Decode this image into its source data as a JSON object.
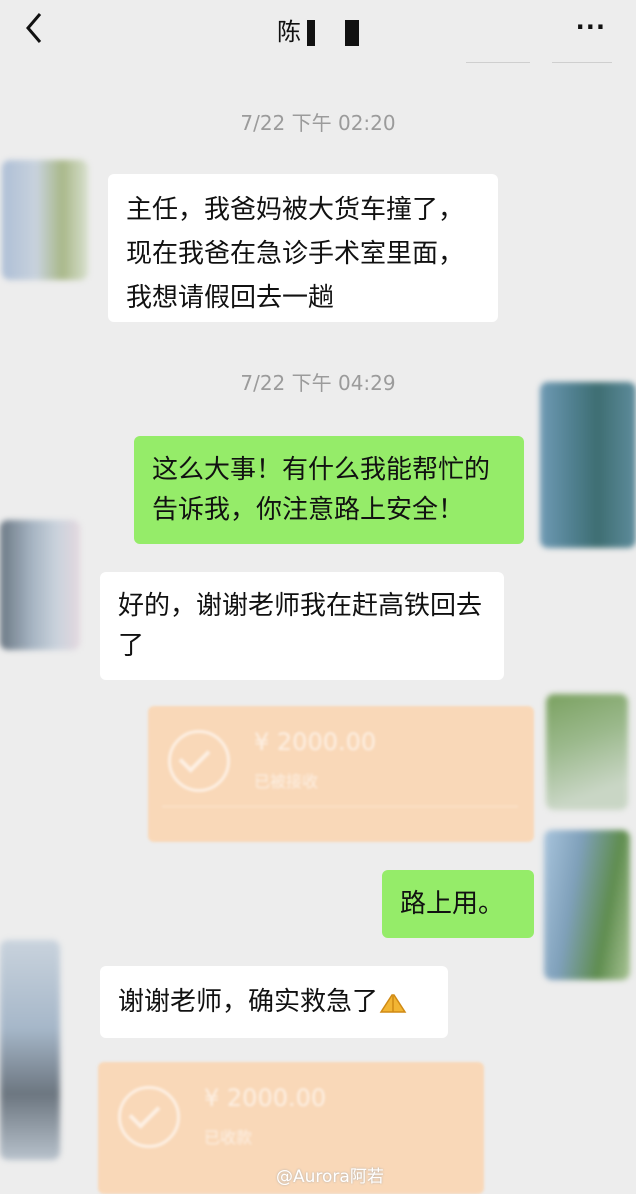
{
  "header": {
    "title": "陈"
  },
  "timestamps": [
    "7/22 下午 02:20",
    "7/22 下午 04:29"
  ],
  "messages": {
    "m1": "主任，我爸妈被大货车撞了，现在我爸在急诊手术室里面，我想请假回去一趟",
    "m2": "这么大事！有什么我能帮忙的告诉我，你注意路上安全！",
    "m3": "好的，谢谢老师我在赶高铁回去了",
    "m4": "路上用。",
    "m5": "谢谢老师，确实救急了"
  },
  "transfers": [
    {
      "amount": "¥ 2000.00",
      "status": "已被接收"
    },
    {
      "amount": "¥ 2000.00",
      "status": "已收款"
    }
  ],
  "watermark": "@Aurora阿若",
  "colors": {
    "background": "#ededed",
    "incoming_bubble": "#ffffff",
    "outgoing_bubble": "#95ec69",
    "transfer_card": "#f9d8b8"
  },
  "icons": [
    "chevron-left-icon",
    "more-icon",
    "check-circle-icon",
    "pray-emoji-icon"
  ]
}
